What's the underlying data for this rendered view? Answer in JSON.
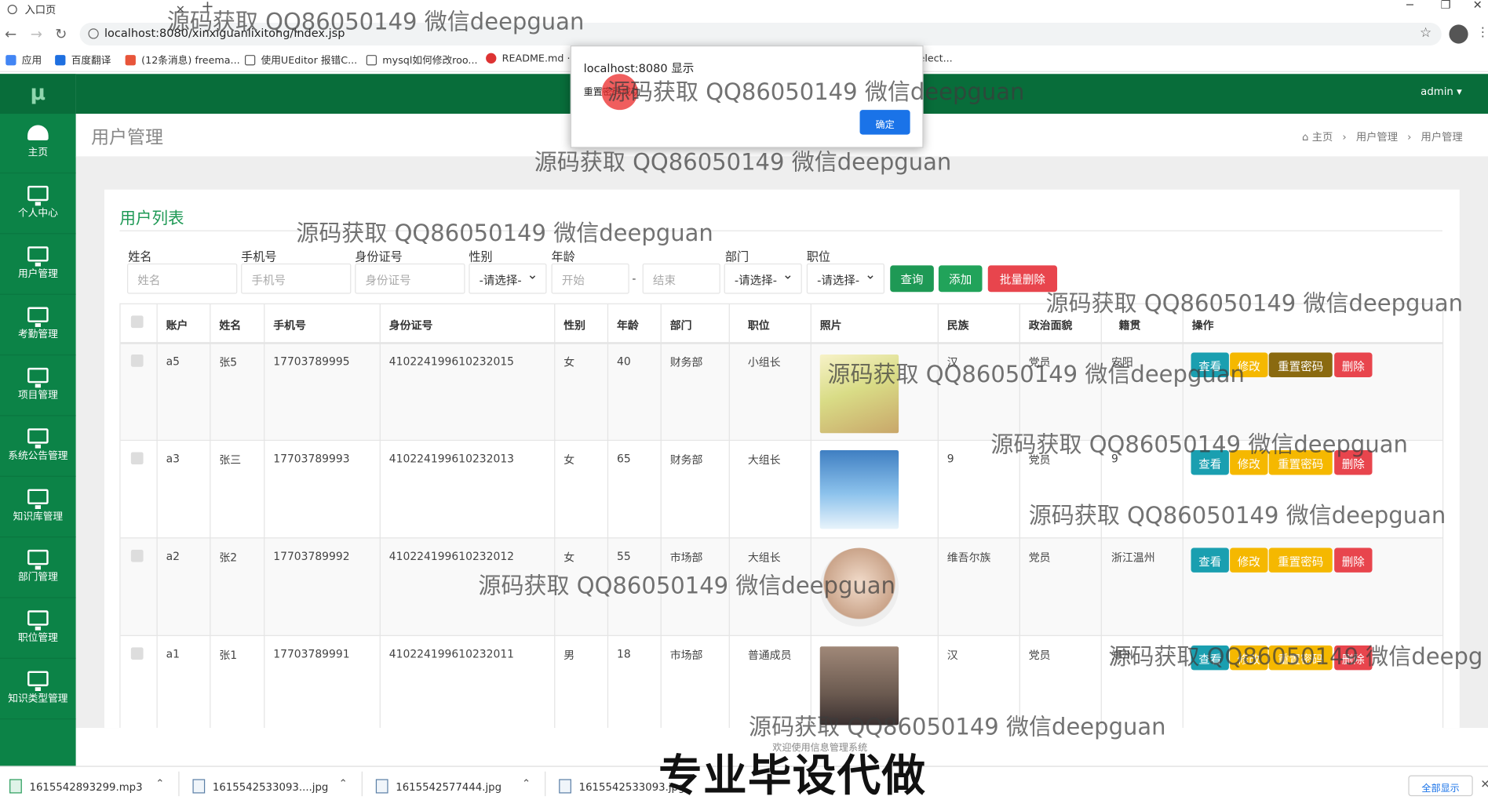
{
  "browser": {
    "tab_title": "入口页",
    "new_tab": "+",
    "window_controls": [
      "─",
      "❐",
      "✕"
    ],
    "url": "localhost:8080/xinxiguanlixitong/index.jsp",
    "bookmarks": [
      "应用",
      "百度翻译",
      "(12条消息) freema...",
      "使用UEditor 报错C...",
      "mysql如何修改roo...",
      "README.md ·",
      "elect..."
    ]
  },
  "dialog": {
    "title": "localhost:8080 显示",
    "message": "重置密码成功",
    "ok": "确定"
  },
  "app": {
    "logo": "μ",
    "user": "admin ▾",
    "nav": [
      "主页",
      "个人中心",
      "用户管理",
      "考勤管理",
      "项目管理",
      "系统公告管理",
      "知识库管理",
      "部门管理",
      "职位管理",
      "知识类型管理"
    ],
    "page_title": "用户管理",
    "breadcrumb": [
      "主页",
      "用户管理",
      "用户管理"
    ],
    "panel_title": "用户列表",
    "footer": "欢迎使用信息管理系统"
  },
  "filters": {
    "name_label": "姓名",
    "name_ph": "姓名",
    "phone_label": "手机号",
    "phone_ph": "手机号",
    "id_label": "身份证号",
    "id_ph": "身份证号",
    "gender_label": "性别",
    "gender_value": "-请选择-",
    "age_label": "年龄",
    "age_start": "开始",
    "age_sep": "-",
    "age_end": "结束",
    "dept_label": "部门",
    "dept_value": "-请选择-",
    "pos_label": "职位",
    "pos_value": "-请选择-",
    "search": "查询",
    "add": "添加",
    "batch_delete": "批量删除"
  },
  "table": {
    "headers": [
      "账户",
      "姓名",
      "手机号",
      "身份证号",
      "性别",
      "年龄",
      "部门",
      "职位",
      "照片",
      "民族",
      "政治面貌",
      "籍贯",
      "操作"
    ],
    "rows": [
      {
        "account": "a5",
        "name": "张5",
        "phone": "17703789995",
        "idno": "410224199610232015",
        "gender": "女",
        "age": "40",
        "dept": "财务部",
        "pos": "小组长",
        "ethnic": "汉",
        "political": "党员",
        "origin": "安阳"
      },
      {
        "account": "a3",
        "name": "张三",
        "phone": "17703789993",
        "idno": "410224199610232013",
        "gender": "女",
        "age": "65",
        "dept": "财务部",
        "pos": "大组长",
        "ethnic": "9",
        "political": "党员",
        "origin": "9"
      },
      {
        "account": "a2",
        "name": "张2",
        "phone": "17703789992",
        "idno": "410224199610232012",
        "gender": "女",
        "age": "55",
        "dept": "市场部",
        "pos": "大组长",
        "ethnic": "维吾尔族",
        "political": "党员",
        "origin": "浙江温州"
      },
      {
        "account": "a1",
        "name": "张1",
        "phone": "17703789991",
        "idno": "410224199610232011",
        "gender": "男",
        "age": "18",
        "dept": "市场部",
        "pos": "普通成员",
        "ethnic": "汉",
        "political": "党员",
        "origin": "郑州"
      }
    ],
    "actions": [
      "查看",
      "修改",
      "重置密码",
      "删除"
    ]
  },
  "downloads": {
    "items": [
      "1615542893299.mp3",
      "1615542533093....jpg",
      "1615542577444.jpg",
      "1615542533093.jpg"
    ],
    "show_all": "全部显示"
  },
  "overlay": {
    "watermark": "源码获取 QQ86050149 微信deepguan",
    "watermark_cut": "源码获取 QQ86050149 微信deepg",
    "banner": "专业毕设代做"
  },
  "colors": {
    "sidebar": "#0c8347",
    "topbar": "#086d3a",
    "view": "#1a9fb0",
    "edit": "#f5b800",
    "reset": "#e8a800",
    "reset_active": "#8a6a10",
    "delete": "#e8454d",
    "add": "#21a35a",
    "batch": "#e8454d"
  }
}
